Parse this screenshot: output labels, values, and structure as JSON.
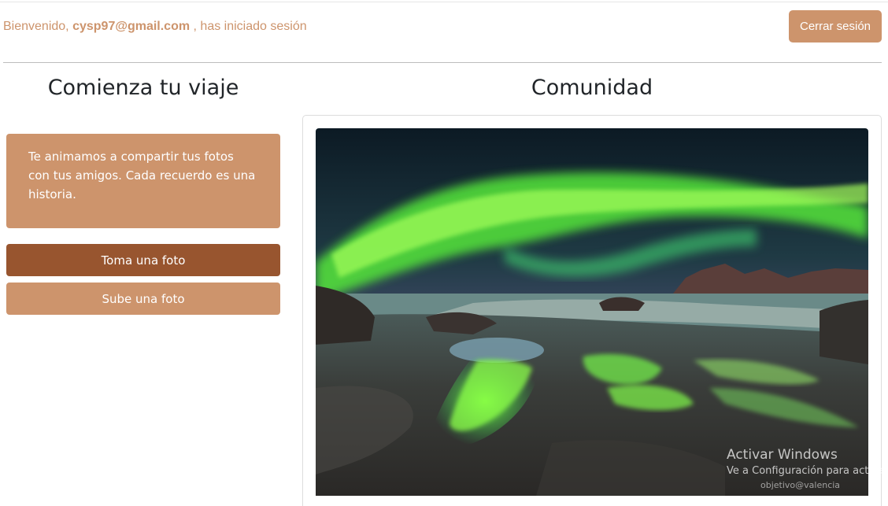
{
  "header": {
    "greeting_prefix": "Bienvenido,",
    "user_email": "cysp97@gmail.com",
    "greeting_suffix": ", has iniciado sesión",
    "logout_label": "Cerrar sesión"
  },
  "left": {
    "title": "Comienza tu viaje",
    "intro_text": "Te animamos a compartir tus fotos con tus amigos. Cada recuerdo es una historia.",
    "take_photo_label": "Toma una foto",
    "upload_photo_label": "Sube una foto"
  },
  "community": {
    "title": "Comunidad",
    "photo_credit": "objetivo@valencia"
  },
  "overlay": {
    "activate_title": "Activar Windows",
    "activate_subtitle": "Ve a Configuración para activar"
  },
  "colors": {
    "accent": "#cd946c",
    "accent_dark": "#98552f",
    "text": "#212529"
  }
}
